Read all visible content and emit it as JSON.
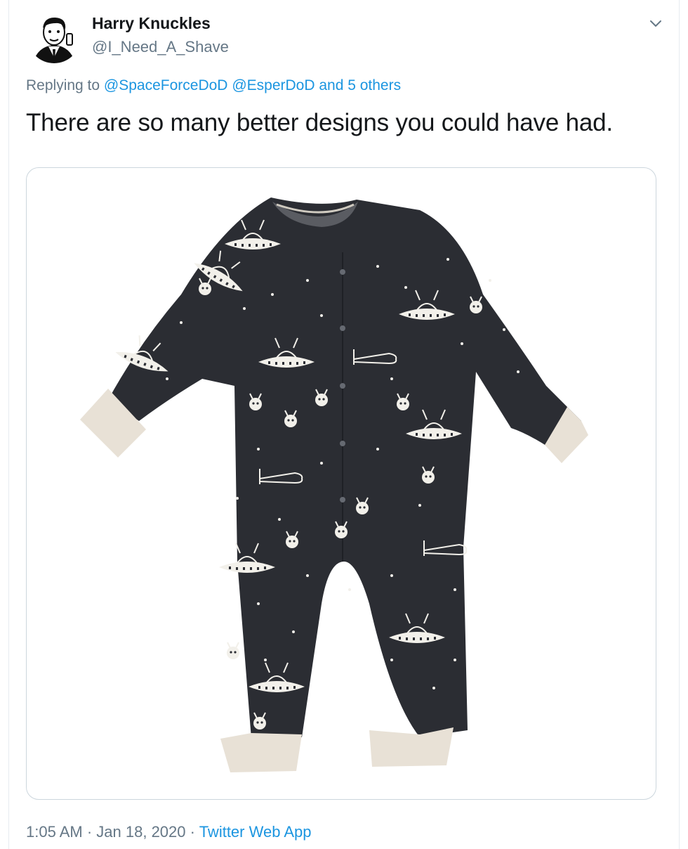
{
  "author": {
    "name": "Harry Knuckles",
    "handle": "@I_Need_A_Shave",
    "avatar_icon": "vintage-man-avatar"
  },
  "reply_context": {
    "prefix": "Replying to",
    "mention1": "@SpaceForceDoD",
    "mention2": "@EsperDoD",
    "others": "and 5 others"
  },
  "tweet_text": "There are so many better designs you could have had.",
  "media": {
    "image_icon": "space-alien-onesie-photo"
  },
  "meta": {
    "time": "1:05 AM",
    "date": "Jan 18, 2020",
    "separator": "·",
    "source": "Twitter Web App"
  },
  "colors": {
    "link": "#1b95e0",
    "secondary_text": "#657786",
    "onesie": "#2b2d33",
    "cuff": "#e8e1d6"
  }
}
